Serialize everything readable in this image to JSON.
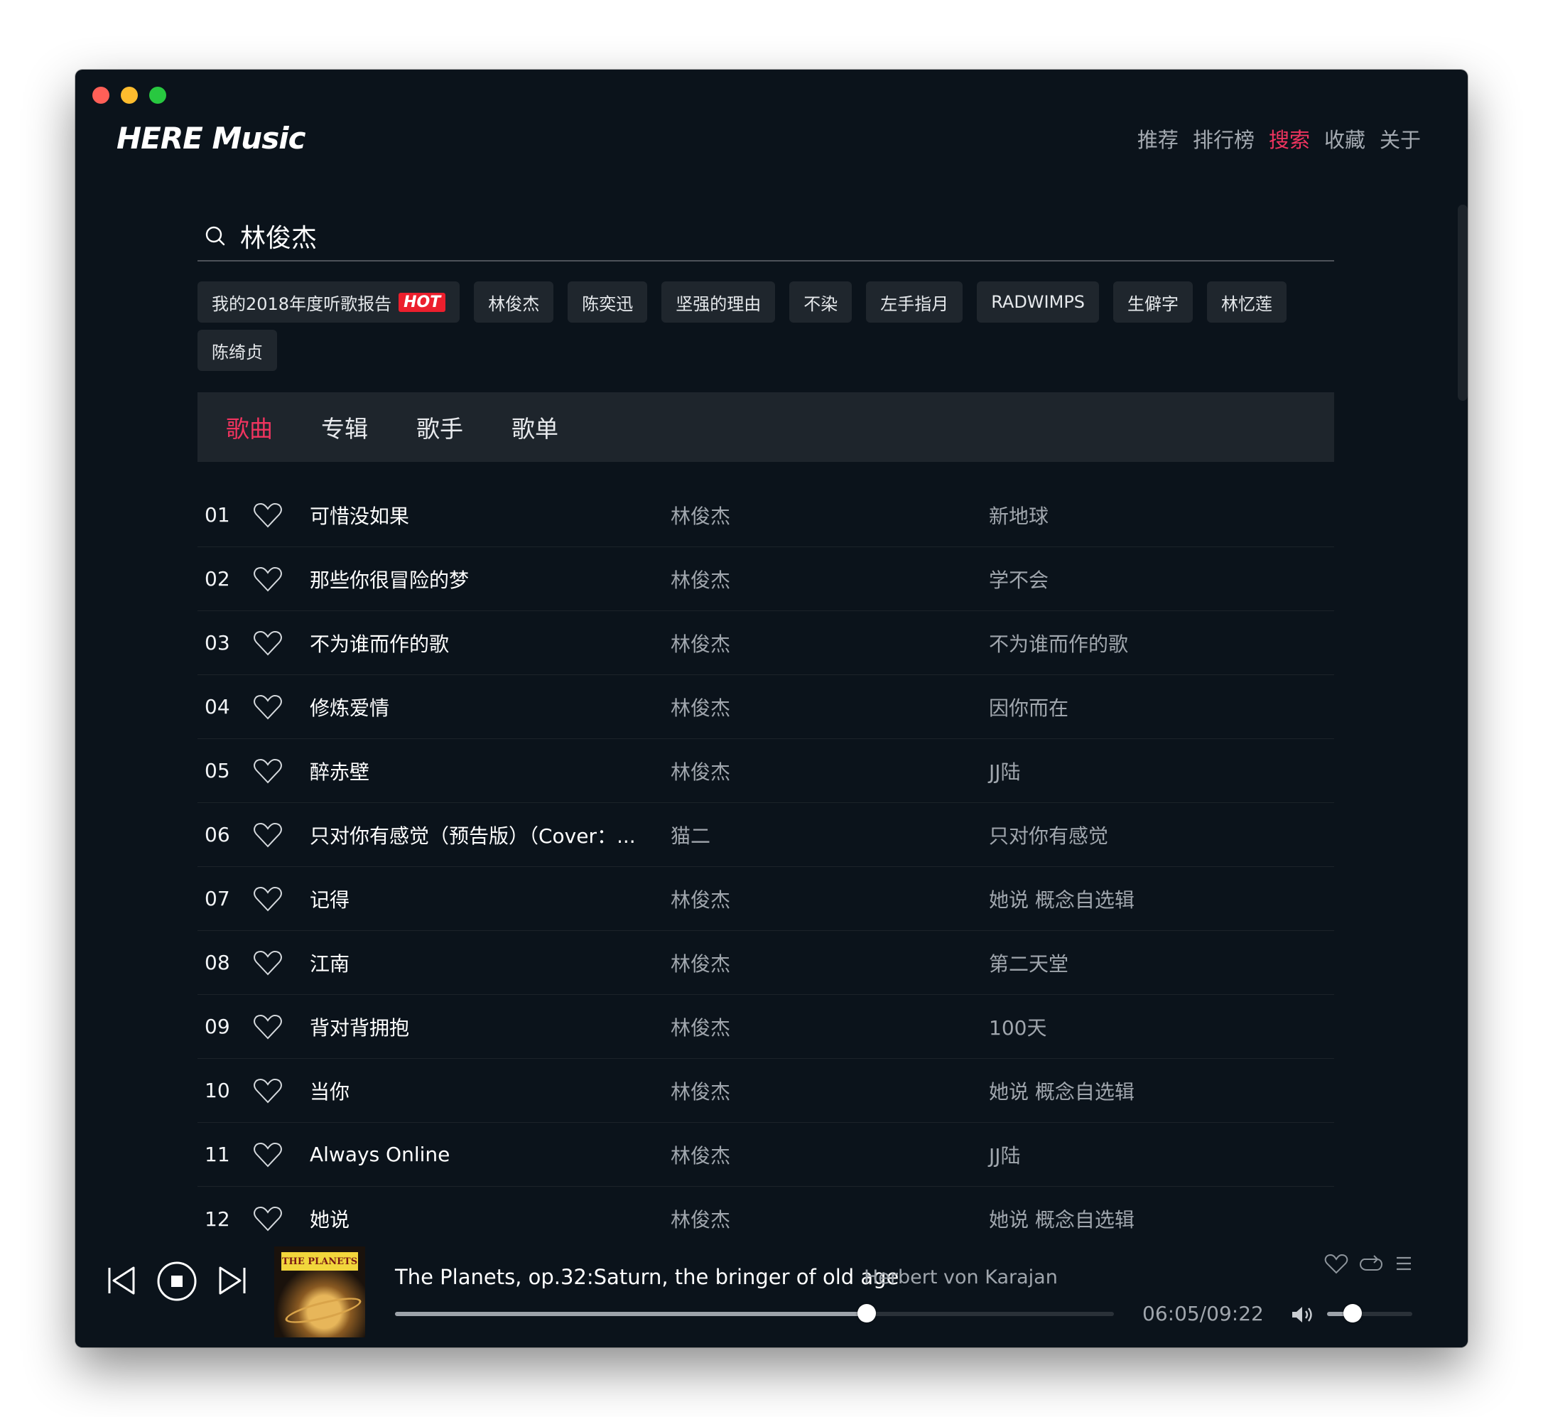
{
  "app": {
    "logo": "HERE Music"
  },
  "nav": [
    {
      "label": "推荐",
      "active": false
    },
    {
      "label": "排行榜",
      "active": false
    },
    {
      "label": "搜索",
      "active": true
    },
    {
      "label": "收藏",
      "active": false
    },
    {
      "label": "关于",
      "active": false
    }
  ],
  "search": {
    "query": "林俊杰"
  },
  "hot_tags": [
    {
      "label": "我的2018年度听歌报告",
      "badge": "HOT"
    },
    {
      "label": "林俊杰"
    },
    {
      "label": "陈奕迅"
    },
    {
      "label": "坚强的理由"
    },
    {
      "label": "不染"
    },
    {
      "label": "左手指月"
    },
    {
      "label": "RADWIMPS"
    },
    {
      "label": "生僻字"
    },
    {
      "label": "林忆莲"
    },
    {
      "label": "陈绮贞"
    }
  ],
  "tabs": [
    {
      "label": "歌曲",
      "active": true
    },
    {
      "label": "专辑",
      "active": false
    },
    {
      "label": "歌手",
      "active": false
    },
    {
      "label": "歌单",
      "active": false
    }
  ],
  "songs": [
    {
      "no": "01",
      "title": "可惜没如果",
      "artist": "林俊杰",
      "album": "新地球"
    },
    {
      "no": "02",
      "title": "那些你很冒险的梦",
      "artist": "林俊杰",
      "album": "学不会"
    },
    {
      "no": "03",
      "title": "不为谁而作的歌",
      "artist": "林俊杰",
      "album": "不为谁而作的歌"
    },
    {
      "no": "04",
      "title": "修炼爱情",
      "artist": "林俊杰",
      "album": "因你而在"
    },
    {
      "no": "05",
      "title": "醉赤壁",
      "artist": "林俊杰",
      "album": "JJ陆"
    },
    {
      "no": "06",
      "title": "只对你有感觉（预告版）（Cover：...",
      "artist": "猫二",
      "album": "只对你有感觉"
    },
    {
      "no": "07",
      "title": "记得",
      "artist": "林俊杰",
      "album": "她说 概念自选辑"
    },
    {
      "no": "08",
      "title": "江南",
      "artist": "林俊杰",
      "album": "第二天堂"
    },
    {
      "no": "09",
      "title": "背对背拥抱",
      "artist": "林俊杰",
      "album": "100天"
    },
    {
      "no": "10",
      "title": "当你",
      "artist": "林俊杰",
      "album": "她说 概念自选辑"
    },
    {
      "no": "11",
      "title": "Always Online",
      "artist": "林俊杰",
      "album": "JJ陆"
    },
    {
      "no": "12",
      "title": "她说",
      "artist": "林俊杰",
      "album": "她说 概念自选辑"
    }
  ],
  "player": {
    "title": "The Planets, op.32:Saturn, the bringer of old age",
    "artist": "Herbert von Karajan",
    "elapsed": "06:05",
    "separator": "/",
    "duration": "09:22",
    "progress": 0.6566,
    "volume": 0.3,
    "cover_text": "THE PLANETS"
  },
  "colors": {
    "accent": "#f0345f",
    "background": "#0b131b",
    "panel": "#1e252c",
    "hot_badge": "#ec1f2d"
  },
  "icons": [
    "search-icon",
    "heart-icon",
    "previous-icon",
    "stop-icon",
    "next-icon",
    "repeat-icon",
    "playlist-icon",
    "volume-icon"
  ]
}
